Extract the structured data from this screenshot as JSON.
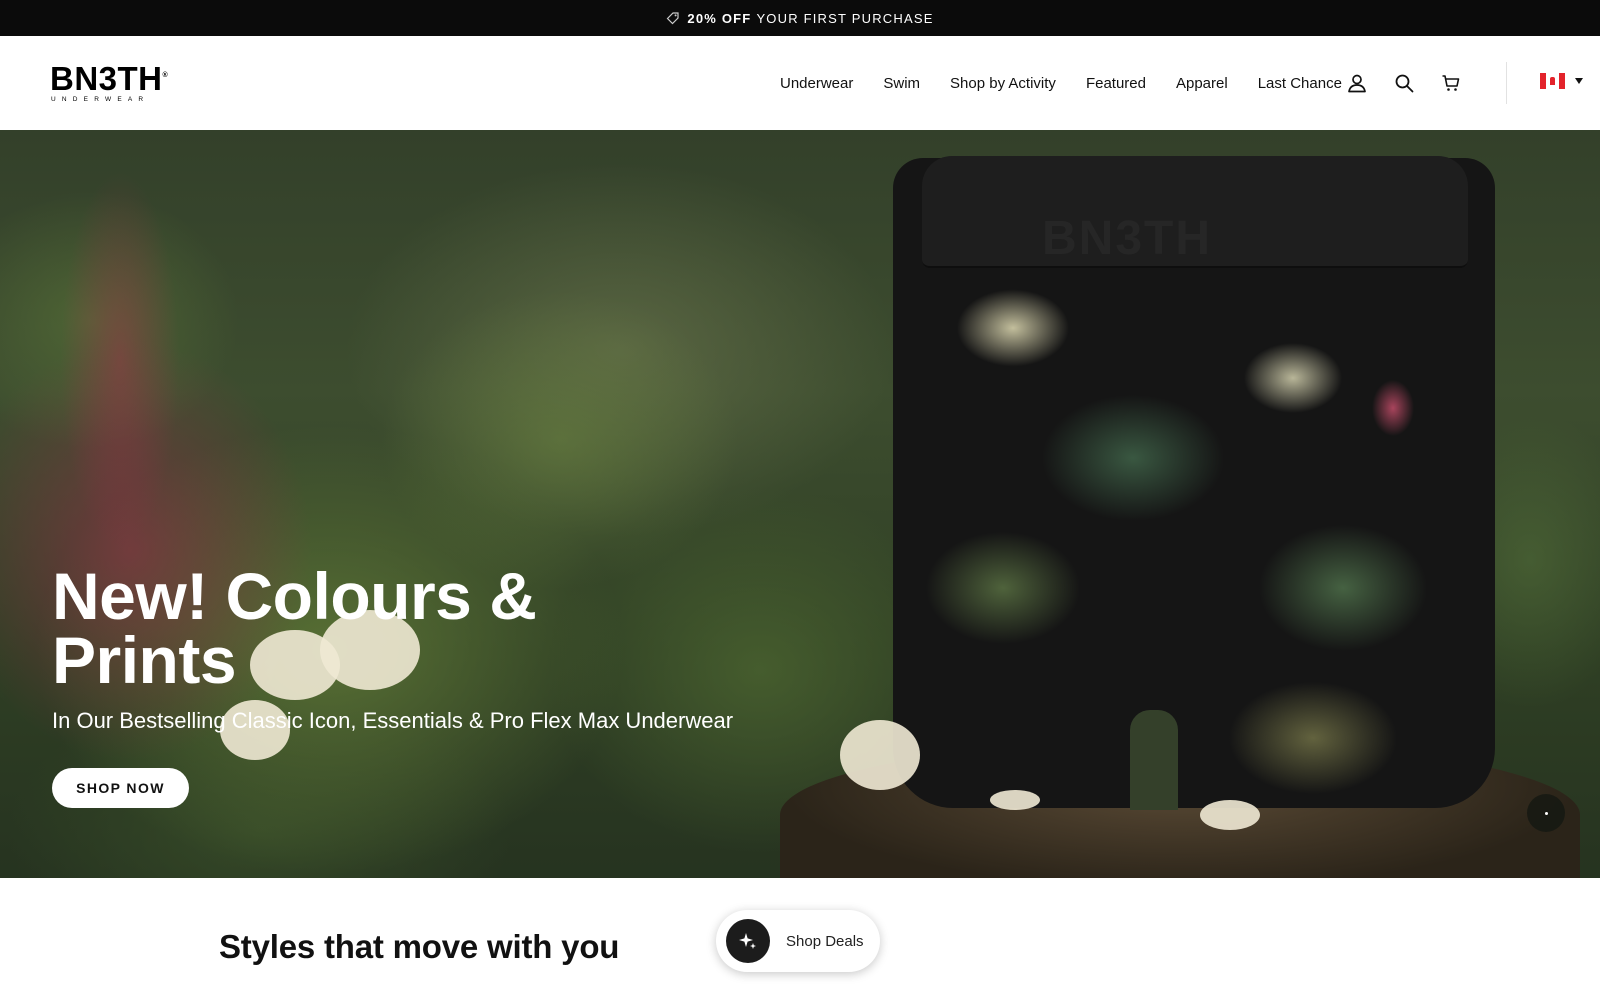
{
  "announcement": {
    "icon": "tag-icon",
    "bold": "20% OFF",
    "rest": "YOUR FIRST PURCHASE"
  },
  "header": {
    "logo": {
      "wordmark": "BN3TH",
      "tm": "®",
      "sub": "UNDERWEAR"
    },
    "nav": [
      "Underwear",
      "Swim",
      "Shop by Activity",
      "Featured",
      "Apparel",
      "Last Chance"
    ],
    "icons": [
      "account-icon",
      "search-icon",
      "cart-icon"
    ],
    "locale": {
      "flag": "canada-flag-icon"
    }
  },
  "hero": {
    "title_line1": "New! Colours &",
    "title_line2": "Prints",
    "subtitle": "In Our Bestselling Classic Icon, Essentials & Pro Flex Max Underwear",
    "cta": "SHOP NOW",
    "waistband_text": "BN3TH"
  },
  "section": {
    "title": "Styles that move with you"
  },
  "deals": {
    "label": "Shop Deals",
    "icon": "sparkle-icon"
  }
}
